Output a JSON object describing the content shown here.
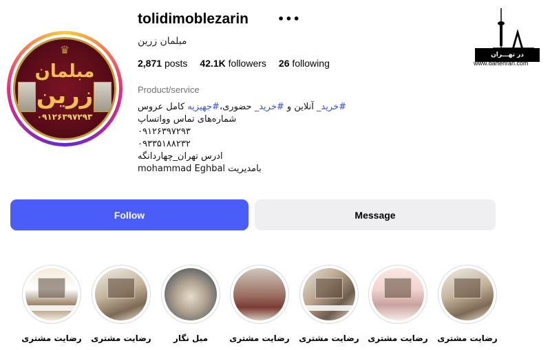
{
  "profile": {
    "username": "tolidimoblezarin",
    "full_name": "مبلمان زرین",
    "stats": {
      "posts": "2,871",
      "posts_label": "posts",
      "followers": "42.1K",
      "followers_label": "followers",
      "following": "26",
      "following_label": "following"
    },
    "category": "Product/service",
    "bio": {
      "line1_tag1": "#خرید_",
      "line1_mid": " آنلاین و ",
      "line1_tag2": "#خرید_",
      "line1_mid2": " حضوری،",
      "line1_tag3": "#جهیزیه",
      "line1_end": " کامل عروس",
      "line2": "شماره‌های تماس وواتساپ",
      "line3": "۰۹۱۲۶۳۹۷۲۹۳",
      "line4": "۰۹۳۳۵۱۸۸۲۳۲",
      "line5": "ادرس تهران_چهاردانگه",
      "line6": "mohammad Eghbal بامدیریت"
    },
    "avatar": {
      "brand_line1": "مبلمان",
      "brand_line2": "زرین",
      "phone": "۰۹۱۲۶۳۹۷۲۹۳"
    }
  },
  "actions": {
    "follow_label": "Follow",
    "message_label": "Message",
    "more_icon": "more-horizontal-icon"
  },
  "logo": {
    "bar_text": "در تهـــران",
    "url": "www.dartehran.com"
  },
  "highlights": [
    {
      "label": "رضایت مشتری"
    },
    {
      "label": "رضایت مشتری"
    },
    {
      "label": "مبل نگار"
    },
    {
      "label": "رضایت مشتری"
    },
    {
      "label": "رضایت مشتری"
    },
    {
      "label": "رضایت مشتری"
    },
    {
      "label": "رضایت مشتری"
    }
  ],
  "colors": {
    "follow_button": "#4a5df9",
    "message_button": "#efeff1",
    "hashtag": "#3b52d6",
    "avatar_bg": "#5a0c18",
    "avatar_text": "#f0c24b"
  }
}
